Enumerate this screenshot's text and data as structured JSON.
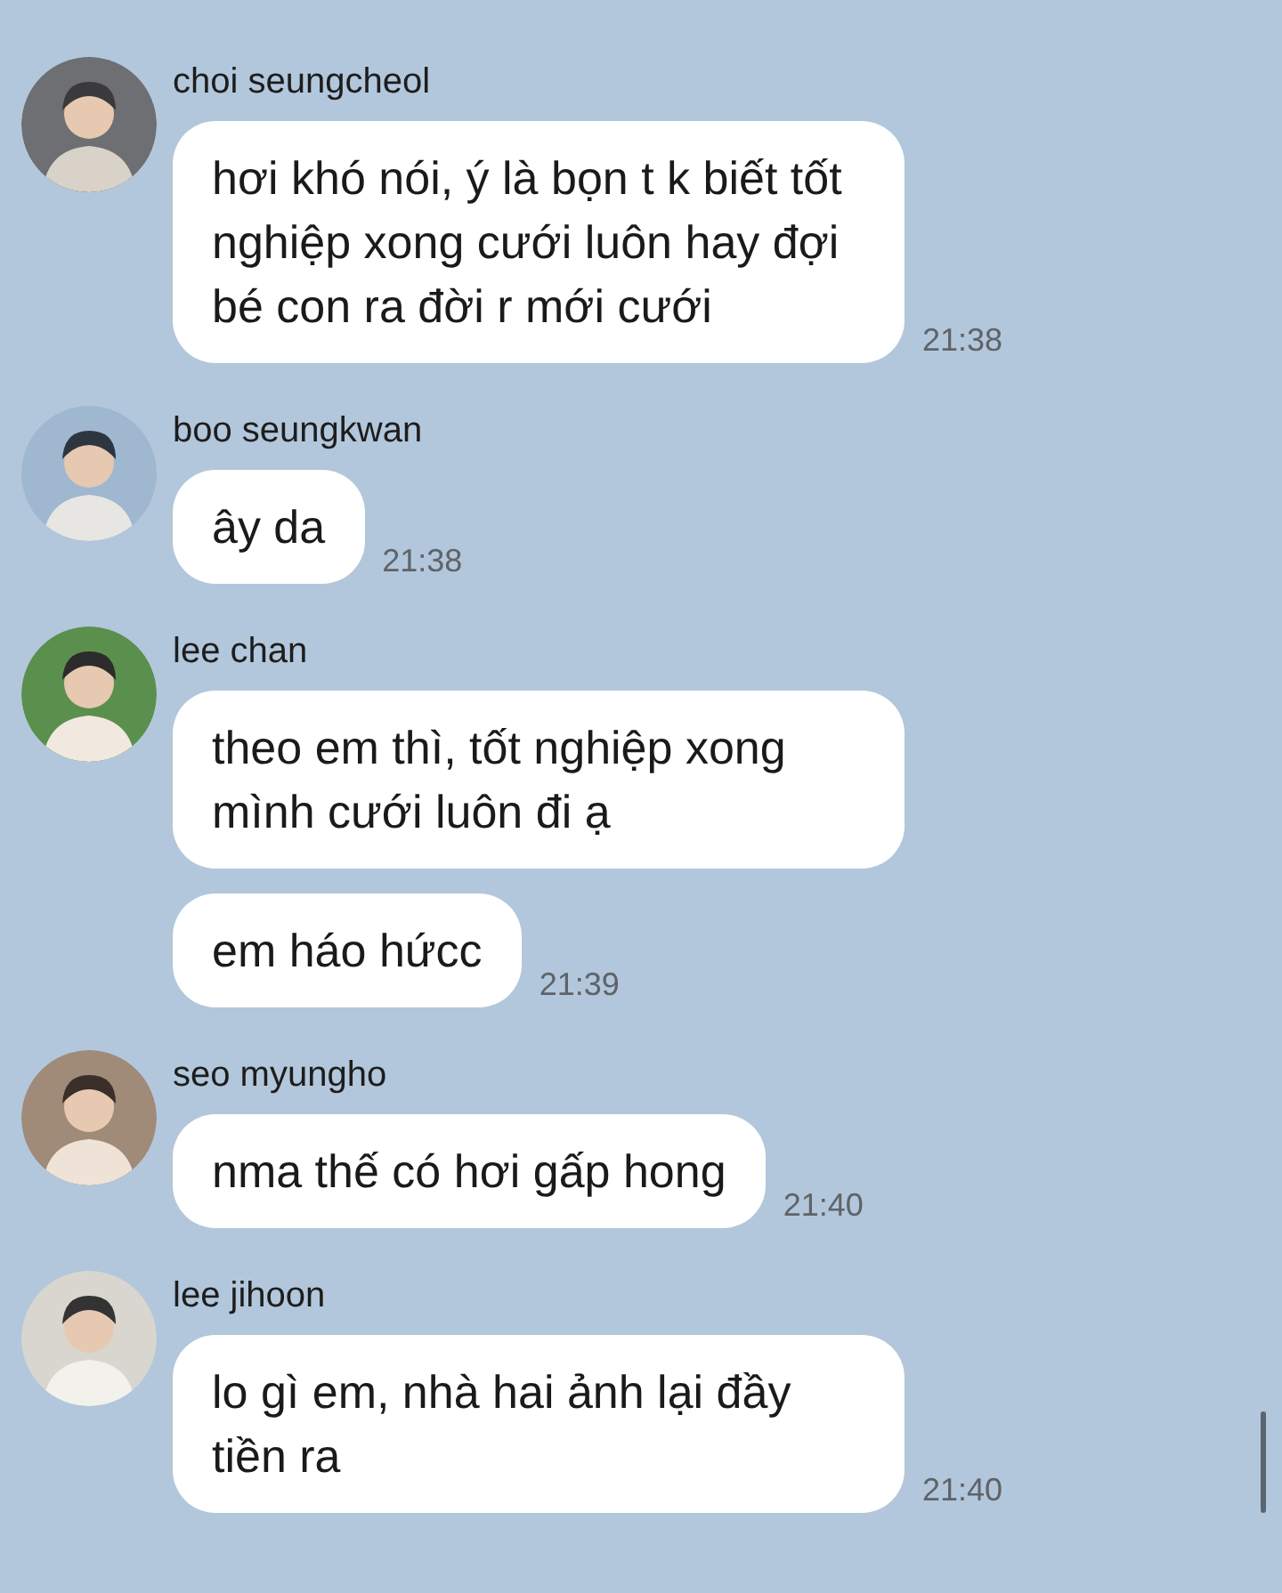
{
  "messages": [
    {
      "sender": "choi seungcheol",
      "avatar": {
        "kind": "picture"
      },
      "bubbles": [
        {
          "text": "hơi khó nói, ý là bọn t k biết tốt nghiệp xong cưới luôn hay đợi bé con ra đời r mới cưới",
          "time": "21:38"
        }
      ]
    },
    {
      "sender": "boo seungkwan",
      "avatar": {
        "kind": "picture"
      },
      "bubbles": [
        {
          "text": "ây da",
          "time": "21:38"
        }
      ]
    },
    {
      "sender": "lee chan",
      "avatar": {
        "kind": "picture"
      },
      "bubbles": [
        {
          "text": "theo em thì, tốt nghiệp xong mình cưới luôn đi ạ"
        },
        {
          "text": "em háo hứcc",
          "time": "21:39"
        }
      ]
    },
    {
      "sender": "seo myungho",
      "avatar": {
        "kind": "picture"
      },
      "bubbles": [
        {
          "text": "nma thế có hơi gấp hong",
          "time": "21:40"
        }
      ]
    },
    {
      "sender": "lee jihoon",
      "avatar": {
        "kind": "picture"
      },
      "bubbles": [
        {
          "text": "lo gì em, nhà hai ảnh lại đầy tiền ra",
          "time": "21:40"
        }
      ]
    }
  ]
}
